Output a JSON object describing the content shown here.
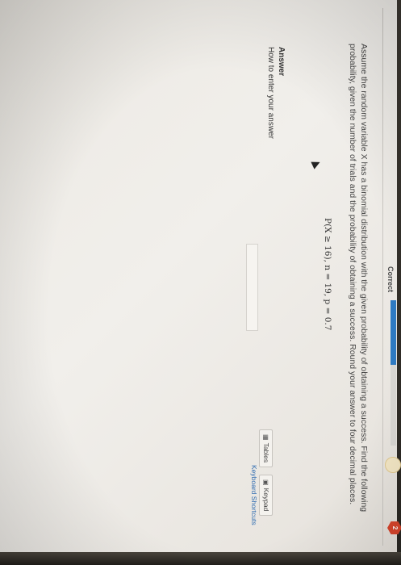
{
  "header": {
    "status_label": "Correct",
    "ring_icon_glyph": "",
    "badge_count": "2",
    "accent_color": "#2e7ac2",
    "badge_color": "#d9452c"
  },
  "question": {
    "text": "Assume the random variable X has a binomial distribution with the given probability of obtaining a success. Find the following probability, given the number of trials and the probability of obtaining a success. Round your answer to four decimal places.",
    "formula": "P(X ≥ 16), n = 19, p = 0.7"
  },
  "answer": {
    "label": "Answer",
    "howto_link": "How to enter your answer",
    "input_value": "",
    "input_placeholder": ""
  },
  "tools": {
    "tables_label": "Tables",
    "tables_icon": "table-icon",
    "keypad_label": "Keypad",
    "keypad_icon": "keypad-icon",
    "shortcuts_link": "Keyboard Shortcuts"
  }
}
